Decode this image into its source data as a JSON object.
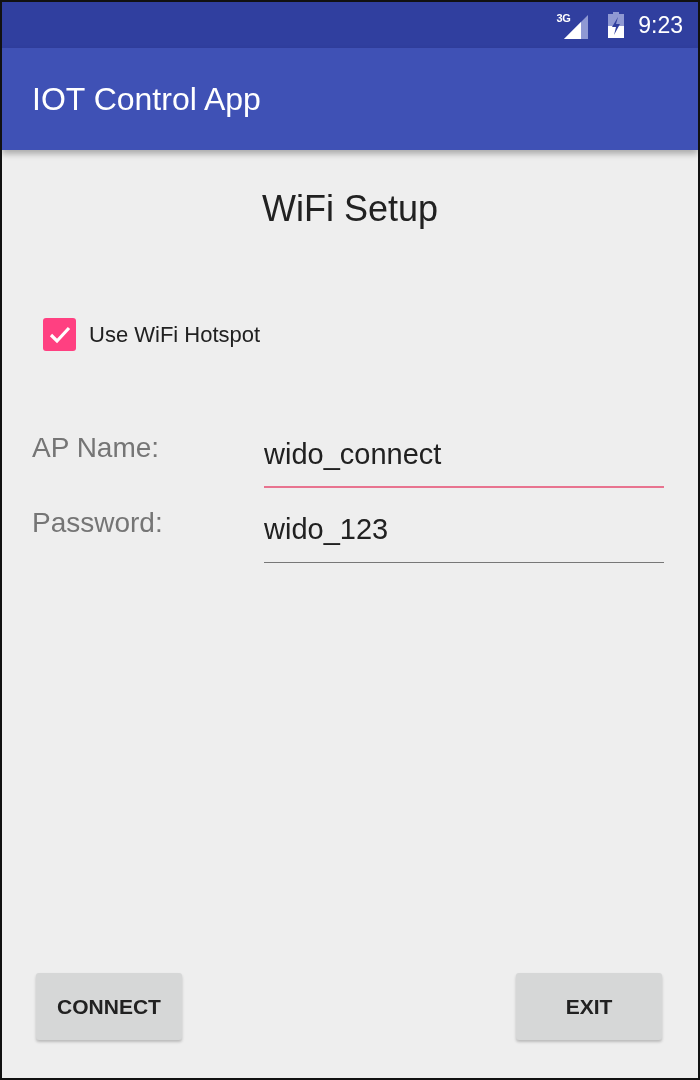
{
  "status_bar": {
    "network_type": "3G",
    "time": "9:23"
  },
  "app_bar": {
    "title": "IOT Control App"
  },
  "heading": "WiFi Setup",
  "hotspot_checkbox": {
    "label": "Use WiFi Hotspot",
    "checked": true
  },
  "fields": [
    {
      "label": "AP Name:",
      "value": "wido_connect",
      "focused": true
    },
    {
      "label": "Password:",
      "value": "wido_123",
      "focused": false
    }
  ],
  "buttons": [
    "CONNECT",
    "EXIT"
  ]
}
